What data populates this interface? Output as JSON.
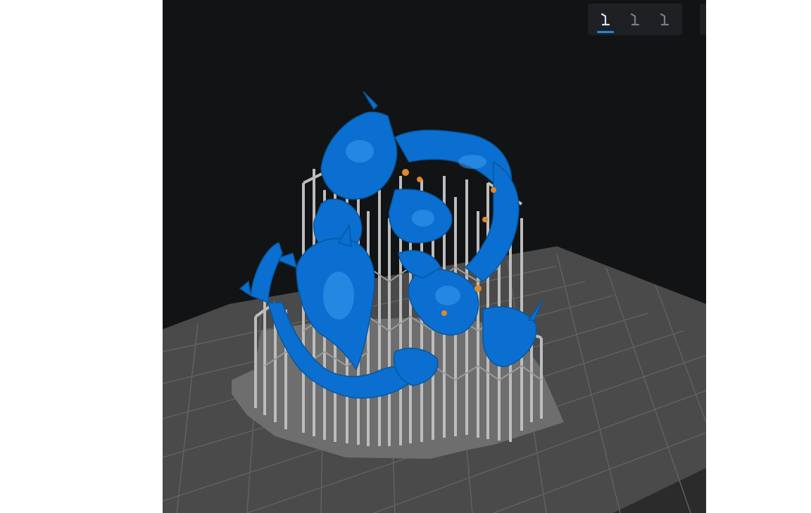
{
  "viewport": {
    "background": "#121315",
    "model_color": "#0a6fd0",
    "support_color": "#b9b9b9",
    "raft_color": "#6e6e6e",
    "plate_color": "#4a4a4a",
    "grid_color": "#606060"
  },
  "view_toolbar": {
    "buttons": [
      {
        "name": "view-mode-1",
        "icon": "support-view-icon",
        "active": true
      },
      {
        "name": "view-mode-2",
        "icon": "support-view-icon",
        "active": false
      },
      {
        "name": "view-mode-3",
        "icon": "support-view-icon",
        "active": false
      }
    ],
    "active_color": "#1e88e5"
  }
}
